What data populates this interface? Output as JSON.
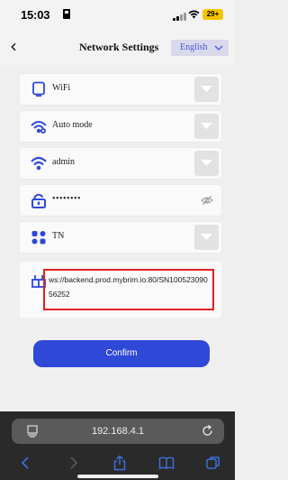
{
  "status_bar": {
    "time": "15:03",
    "battery": "29+"
  },
  "header": {
    "title": "Network Settings",
    "language": "English"
  },
  "form": {
    "rows": [
      {
        "label": "WiFi",
        "icon": "tablet-icon"
      },
      {
        "label": "Auto mode",
        "icon": "wifi-auto-icon"
      },
      {
        "label": "admin",
        "icon": "wifi-icon"
      },
      {
        "label": "••••••••",
        "icon": "lock-icon"
      },
      {
        "label": "TN",
        "icon": "grid-icon"
      }
    ],
    "url": "ws://backend.prod.mybrim.io:80/SN10052309056252"
  },
  "confirm_label": "Confirm",
  "browser": {
    "address": "192.168.4.1"
  },
  "colors": {
    "accent": "#2f48d8",
    "highlight": "#e02020",
    "lang_text": "#4a59d8"
  }
}
